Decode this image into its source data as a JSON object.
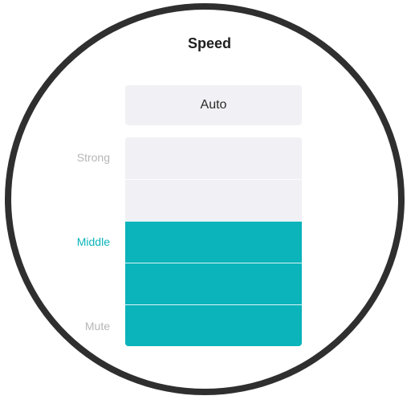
{
  "header": {
    "title": "Speed"
  },
  "auto_button": {
    "label": "Auto"
  },
  "speed_slider": {
    "levels": [
      {
        "label": "Strong",
        "state": "inactive"
      },
      {
        "label": "Middle",
        "state": "active"
      },
      {
        "label": "Mute",
        "state": "inactive"
      }
    ],
    "segments_total": 5,
    "segments_filled": 3,
    "fill_fraction": 0.6,
    "selected_level": "Middle"
  },
  "colors": {
    "accent": "#0bb3ba",
    "inactive_fill": "#f1f1f5",
    "inactive_label": "#b6b6b6",
    "bezel": "#2f2f2f"
  }
}
